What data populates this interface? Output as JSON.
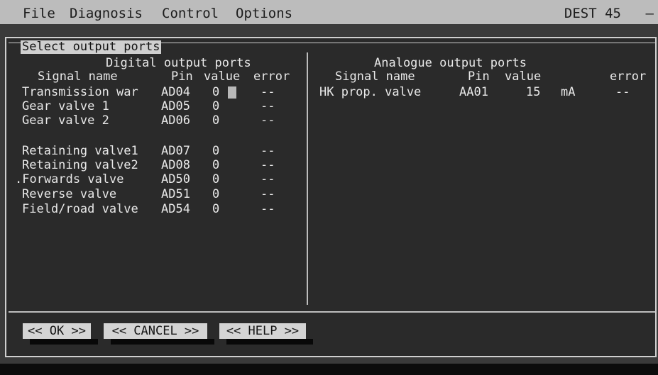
{
  "menubar": {
    "items": [
      "File",
      "Diagnosis",
      "Control",
      "Options"
    ],
    "device": "DEST 45",
    "dash": "—"
  },
  "dialog": {
    "title": "Select output ports",
    "digital": {
      "heading": "Digital output ports",
      "headers": [
        "Signal name",
        "Pin",
        "value",
        "error"
      ],
      "rows": [
        {
          "name": "Transmission war",
          "pin": "AD04",
          "value": "0",
          "error": "--"
        },
        {
          "name": "Gear valve 1",
          "pin": "AD05",
          "value": "0",
          "error": "--"
        },
        {
          "name": "Gear valve 2",
          "pin": "AD06",
          "value": "0",
          "error": "--"
        },
        {
          "name": "Retaining valve1",
          "pin": "AD07",
          "value": "0",
          "error": "--"
        },
        {
          "name": "Retaining valve2",
          "pin": "AD08",
          "value": "0",
          "error": "--"
        },
        {
          "name": ".Forwards valve",
          "pin": "AD50",
          "value": "0",
          "error": "--"
        },
        {
          "name": "Reverse valve",
          "pin": "AD51",
          "value": "0",
          "error": "--"
        },
        {
          "name": "Field/road valve",
          "pin": "AD54",
          "value": "0",
          "error": "--"
        }
      ]
    },
    "analogue": {
      "heading": "Analogue output ports",
      "headers": [
        "Signal name",
        "Pin",
        "value",
        "error"
      ],
      "rows": [
        {
          "name": "HK prop. valve",
          "pin": "AA01",
          "value": "15",
          "unit": "mA",
          "error": "--"
        }
      ]
    },
    "buttons": {
      "ok": "<< OK >>",
      "cancel": "<< CANCEL >>",
      "help": "<< HELP >>"
    }
  }
}
